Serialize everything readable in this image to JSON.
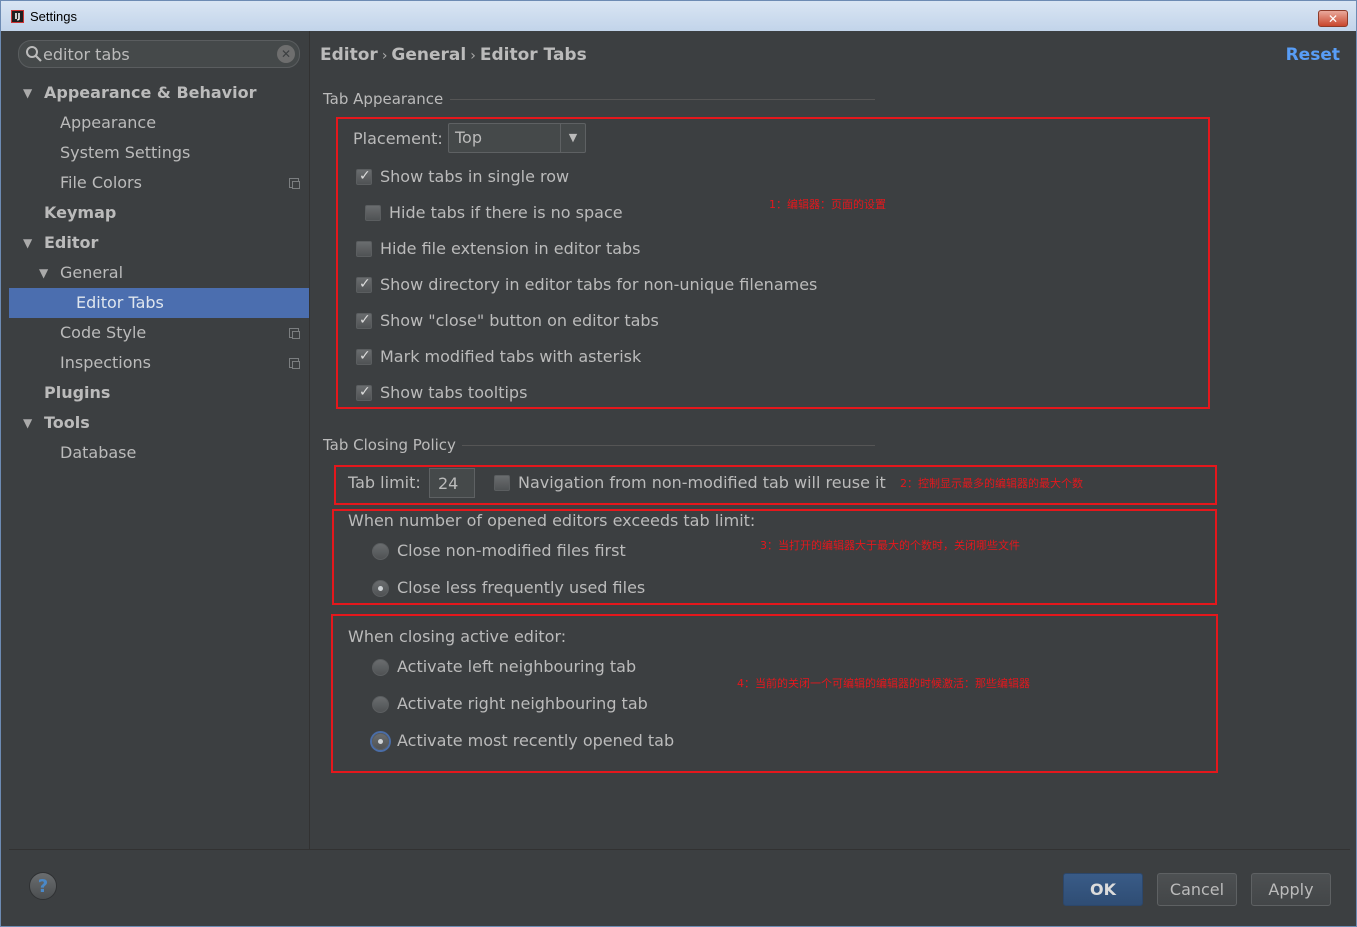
{
  "window": {
    "title": "Settings"
  },
  "search": {
    "value": "editor tabs"
  },
  "tree": [
    {
      "label": "Appearance & Behavior",
      "bold": true,
      "arrow": "▼"
    },
    {
      "label": "Appearance"
    },
    {
      "label": "System Settings"
    },
    {
      "label": "File Colors",
      "copy": true
    },
    {
      "label": "Keymap",
      "bold": true
    },
    {
      "label": "Editor",
      "bold": true,
      "arrow": "▼"
    },
    {
      "label": "General",
      "arrow": "▼"
    },
    {
      "label": "Editor Tabs",
      "selected": true
    },
    {
      "label": "Code Style",
      "copy": true
    },
    {
      "label": "Inspections",
      "copy": true
    },
    {
      "label": "Plugins",
      "bold": true
    },
    {
      "label": "Tools",
      "bold": true,
      "arrow": "▼"
    },
    {
      "label": "Database"
    }
  ],
  "breadcrumb": {
    "item1": "Editor",
    "item2": "General",
    "item3": "Editor Tabs",
    "sep": "›"
  },
  "reset_label": "Reset",
  "tab_appearance": {
    "title": "Tab Appearance",
    "placement_label": "Placement:",
    "placement_value": "Top",
    "options": [
      {
        "label": "Show tabs in single row",
        "checked": true
      },
      {
        "label": "Hide tabs if there is no space",
        "checked": false
      },
      {
        "label": "Hide file extension in editor tabs",
        "checked": false
      },
      {
        "label": "Show directory in editor tabs for non-unique filenames",
        "checked": true
      },
      {
        "label": "Show \"close\" button on editor tabs",
        "checked": true
      },
      {
        "label": "Mark modified tabs with asterisk",
        "checked": true
      },
      {
        "label": "Show tabs tooltips",
        "checked": true
      }
    ],
    "note": "1：编辑器：页面的设置"
  },
  "tab_closing": {
    "title": "Tab Closing Policy",
    "tab_limit_label": "Tab limit:",
    "tab_limit_value": "24",
    "reuse_label": "Navigation from non-modified tab will reuse it",
    "reuse_checked": false,
    "note_limit": "2：控制显示最多的编辑器的最大个数",
    "exceeds_label": "When number of opened editors exceeds tab limit:",
    "exceeds_options": [
      {
        "label": "Close non-modified files first",
        "selected": false
      },
      {
        "label": "Close less frequently used files",
        "selected": true
      }
    ],
    "note_exceeds": "3：当打开的编辑器大于最大的个数时，关闭哪些文件",
    "closing_label": "When closing active editor:",
    "closing_options": [
      {
        "label": "Activate left neighbouring tab",
        "selected": false
      },
      {
        "label": "Activate right neighbouring tab",
        "selected": false
      },
      {
        "label": "Activate most recently opened tab",
        "selected": true
      }
    ],
    "note_closing": "4：当前的关闭一个可编辑的编辑器的时候激活：那些编辑器"
  },
  "footer": {
    "help": "?",
    "ok": "OK",
    "cancel": "Cancel",
    "apply": "Apply"
  },
  "colors": {
    "accent": "#4b6eaf",
    "link": "#589df6",
    "annotation": "#e5171c",
    "background": "#3c3f41"
  }
}
